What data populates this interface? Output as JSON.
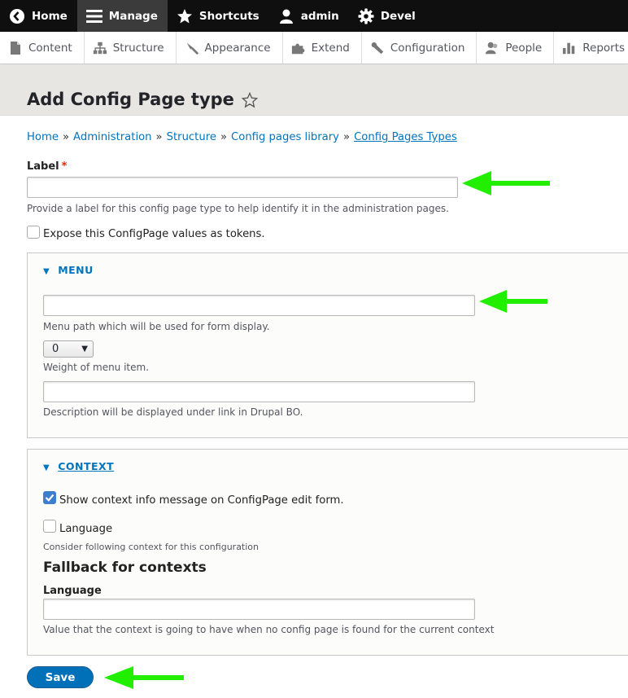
{
  "toolbar": {
    "home": "Home",
    "manage": "Manage",
    "shortcuts": "Shortcuts",
    "user": "admin",
    "devel": "Devel"
  },
  "tray": {
    "content": "Content",
    "structure": "Structure",
    "appearance": "Appearance",
    "extend": "Extend",
    "configuration": "Configuration",
    "people": "People",
    "reports": "Reports"
  },
  "page": {
    "title": "Add Config Page type"
  },
  "breadcrumb": {
    "home": "Home",
    "administration": "Administration",
    "structure": "Structure",
    "library": "Config pages library",
    "types": "Config Pages Types",
    "separator": "»"
  },
  "form": {
    "label_title": "Label",
    "required_mark": "*",
    "label_value": "",
    "label_description": "Provide a label for this config page type to help identify it in the administration pages.",
    "tokens_label": "Expose this ConfigPage values as tokens.",
    "menu": {
      "summary": "MENU",
      "path_value": "",
      "path_description": "Menu path which will be used for form display.",
      "weight_value": "0",
      "weight_description": "Weight of menu item.",
      "desc_value": "",
      "desc_description": "Description will be displayed under link in Drupal BO."
    },
    "context": {
      "summary": "CONTEXT",
      "show_info_label": "Show context info message on ConfigPage edit form.",
      "show_info_checked": true,
      "language_label": "Language",
      "consider_text": "Consider following context for this configuration",
      "fallback_title": "Fallback for contexts",
      "fallback_language_label": "Language",
      "fallback_language_value": "",
      "fallback_description": "Value that the context is going to have when no config page is found for the current context"
    },
    "save_label": "Save"
  },
  "colors": {
    "link": "#0074bd",
    "arrow": "#22ee00",
    "save_button": "#0071b8"
  }
}
